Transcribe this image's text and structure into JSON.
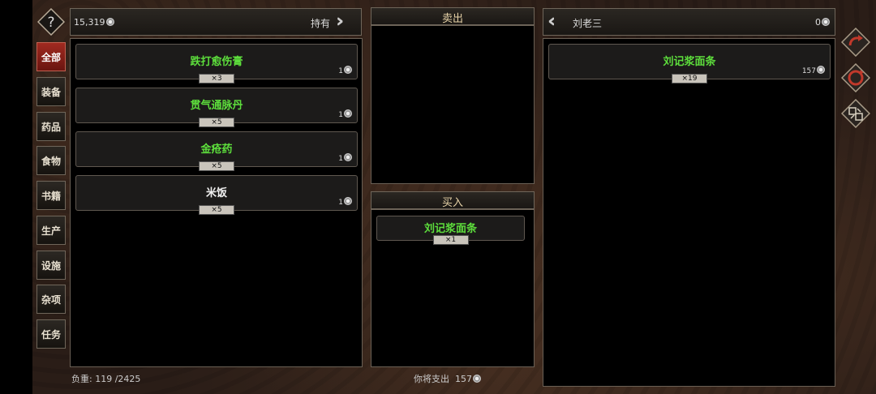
{
  "inventory": {
    "money": "15,319",
    "hold_label": "持有",
    "weight_label": "负重:",
    "weight_value": "119 /2425",
    "items": [
      {
        "name": "跌打愈伤膏",
        "qty": "×3",
        "price": "1",
        "color": "#5dde3c"
      },
      {
        "name": "贯气通脉丹",
        "qty": "×5",
        "price": "1",
        "color": "#5dde3c"
      },
      {
        "name": "金疮药",
        "qty": "×5",
        "price": "1",
        "color": "#5dde3c"
      },
      {
        "name": "米饭",
        "qty": "×5",
        "price": "1",
        "color": "#f2f2f2"
      }
    ]
  },
  "categories": [
    "全部",
    "装备",
    "药品",
    "食物",
    "书籍",
    "生产",
    "设施",
    "杂项",
    "任务"
  ],
  "sell": {
    "title": "卖出"
  },
  "buy": {
    "title": "买入",
    "items": [
      {
        "name": "刘记浆面条",
        "qty": "×1",
        "color": "#5dde3c"
      }
    ],
    "footer_label": "你将支出",
    "footer_value": "157"
  },
  "merchant": {
    "name": "刘老三",
    "money": "0",
    "items": [
      {
        "name": "刘记浆面条",
        "qty": "×19",
        "price": "157",
        "color": "#5dde3c"
      }
    ]
  },
  "icons": {
    "help": "question-diamond-icon",
    "forward": "double-chevron-right-icon",
    "back": "double-chevron-left-icon",
    "redo": "redo-arrow-icon",
    "refresh": "refresh-icon",
    "swap": "swap-icon",
    "coin": "coin-icon"
  }
}
